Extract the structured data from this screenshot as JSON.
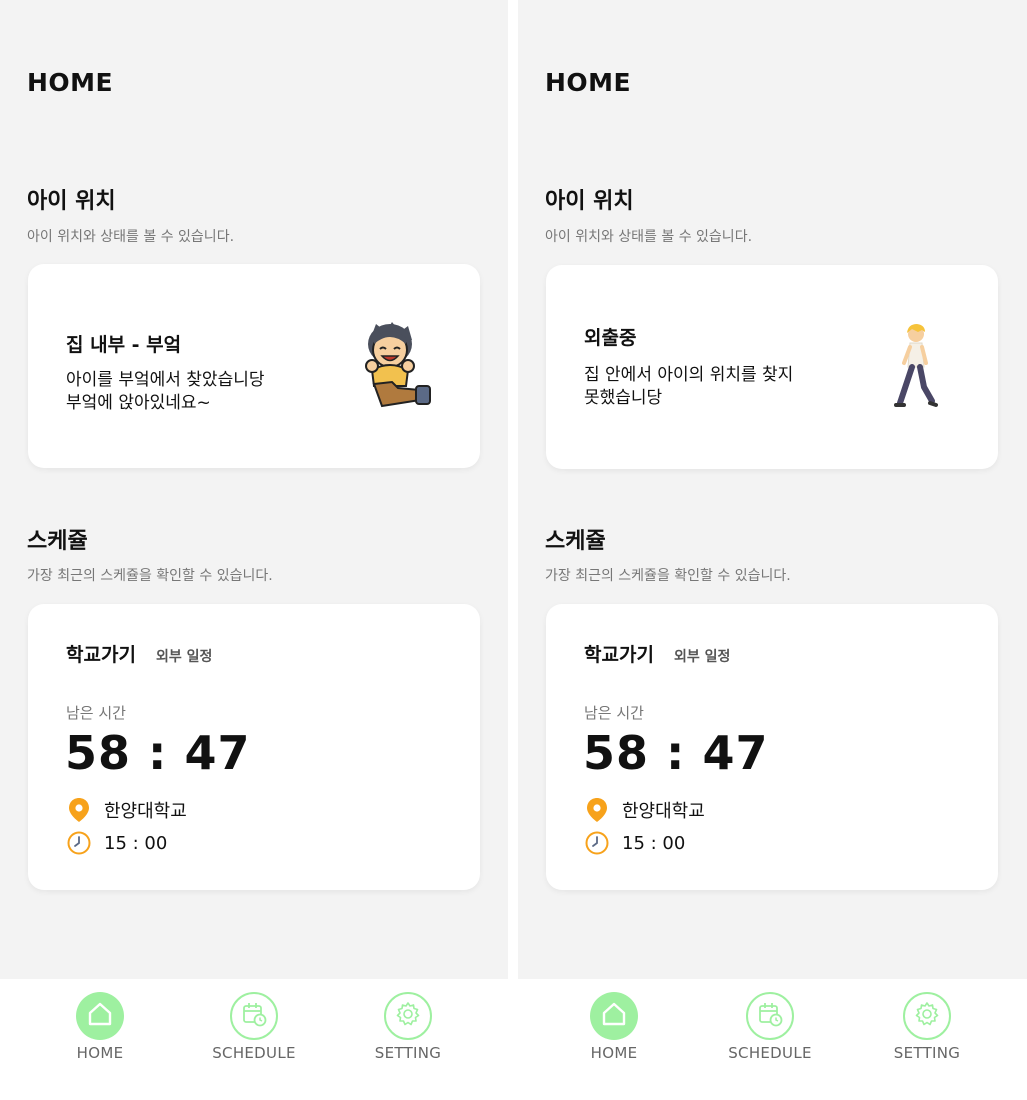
{
  "screens": [
    {
      "header": {
        "title": "HOME"
      },
      "location": {
        "title": "아이 위치",
        "description": "아이 위치와 상태를 볼 수 있습니다.",
        "card": {
          "status_title": "집 내부 - 부엌",
          "lines": [
            "아이를 부엌에서 찾았습니당",
            "부엌에 앉아있네요~"
          ],
          "figure": "sitting-child-icon"
        }
      },
      "schedule": {
        "title": "스케쥴",
        "description": "가장 최근의 스케쥴을 확인할 수 있습니다.",
        "card": {
          "name": "학교가기",
          "type": "외부 일정",
          "remaining_label": "남은 시간",
          "remaining_time": "58 : 47",
          "place": "한양대학교",
          "time": "15 : 00"
        }
      },
      "tabbar": {
        "items": [
          {
            "label": "HOME",
            "icon": "home-icon",
            "active": true
          },
          {
            "label": "SCHEDULE",
            "icon": "calendar-clock-icon",
            "active": false
          },
          {
            "label": "SETTING",
            "icon": "gear-icon",
            "active": false
          }
        ]
      }
    },
    {
      "header": {
        "title": "HOME"
      },
      "location": {
        "title": "아이 위치",
        "description": "아이 위치와 상태를 볼 수 있습니다.",
        "card": {
          "status_title": "외출중",
          "lines": [
            "집 안에서 아이의 위치를 찾지",
            "못했습니당"
          ],
          "figure": "walking-child-icon"
        }
      },
      "schedule": {
        "title": "스케쥴",
        "description": "가장 최근의 스케쥴을 확인할 수 있습니다.",
        "card": {
          "name": "학교가기",
          "type": "외부 일정",
          "remaining_label": "남은 시간",
          "remaining_time": "58 : 47",
          "place": "한양대학교",
          "time": "15 : 00"
        }
      },
      "tabbar": {
        "items": [
          {
            "label": "HOME",
            "icon": "home-icon",
            "active": true
          },
          {
            "label": "SCHEDULE",
            "icon": "calendar-clock-icon",
            "active": false
          },
          {
            "label": "SETTING",
            "icon": "gear-icon",
            "active": false
          }
        ]
      }
    }
  ],
  "colors": {
    "background": "#f3f3f3",
    "card": "#ffffff",
    "accent_green": "#9ef0a0",
    "pin_orange": "#f7a21b",
    "text_muted": "#777777"
  }
}
